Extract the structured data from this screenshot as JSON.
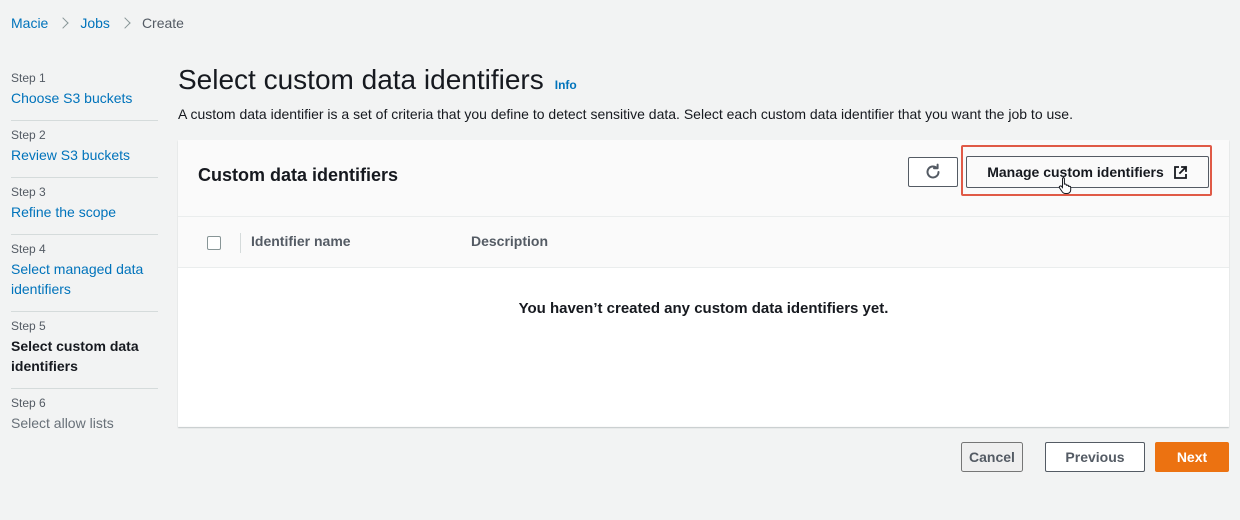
{
  "breadcrumb": {
    "items": [
      "Macie",
      "Jobs",
      "Create"
    ]
  },
  "steps": [
    {
      "num": "Step 1",
      "title": "Choose S3 buckets"
    },
    {
      "num": "Step 2",
      "title": "Review S3 buckets"
    },
    {
      "num": "Step 3",
      "title": "Refine the scope"
    },
    {
      "num": "Step 4",
      "title": "Select managed data identifiers"
    },
    {
      "num": "Step 5",
      "title": "Select custom data identifiers"
    },
    {
      "num": "Step 6",
      "title": "Select allow lists"
    }
  ],
  "page": {
    "title": "Select custom data identifiers",
    "info_label": "Info",
    "description": "A custom data identifier is a set of criteria that you define to detect sensitive data. Select each custom data identifier that you want the job to use."
  },
  "container": {
    "title": "Custom data identifiers",
    "manage_label": "Manage custom identifiers",
    "columns": [
      "Identifier name",
      "Description"
    ],
    "empty_message": "You haven’t created any custom data identifiers yet."
  },
  "footer": {
    "cancel": "Cancel",
    "previous": "Previous",
    "next": "Next"
  },
  "colors": {
    "link": "#0073bb",
    "primary": "#ec7211",
    "highlight": "#e05a47"
  }
}
